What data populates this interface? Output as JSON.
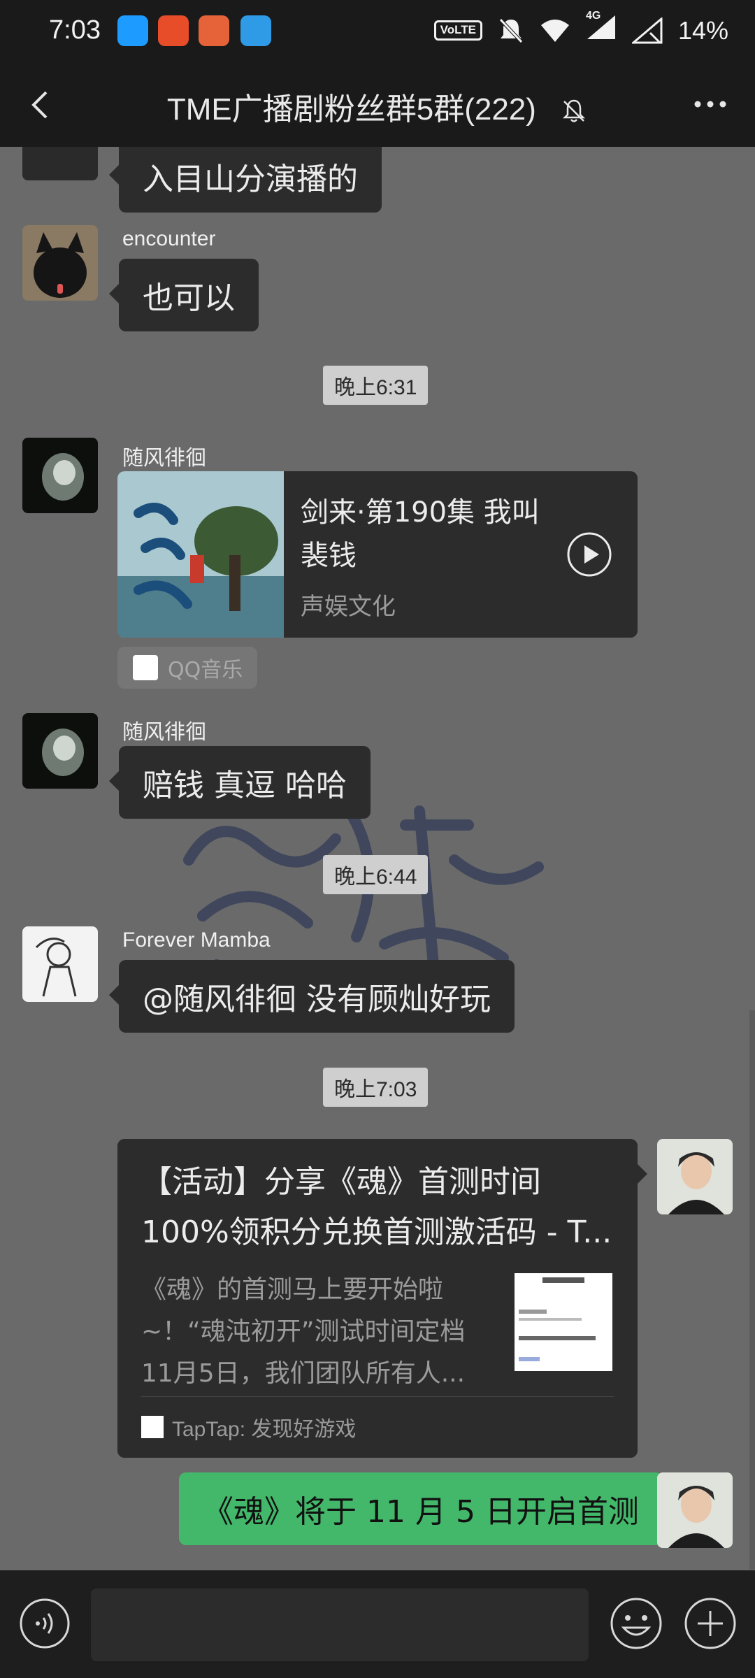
{
  "status_bar": {
    "time": "7:03",
    "volte": "VoLTE",
    "network": "4G",
    "battery": "14%"
  },
  "header": {
    "title": "TME广播剧粉丝群5群(222)"
  },
  "messages": {
    "m0_text": "入目山分演播的",
    "m1_name": "encounter",
    "m1_text": "也可以",
    "time1": "晚上6:31",
    "m2_name": "随风徘徊",
    "m2_music_title": "剑来·第190集 我叫裴钱",
    "m2_music_artist": "声娱文化",
    "m2_source": "QQ音乐",
    "m3_name": "随风徘徊",
    "m3_text": "赔钱 真逗 哈哈",
    "time2": "晚上6:44",
    "m4_name": "Forever Mamba",
    "m4_text": "@随风徘徊  没有顾灿好玩",
    "time3": "晚上7:03",
    "m5_title": "【活动】分享《魂》首测时间100%领积分兑换首测激活码 - T...",
    "m5_desc": "《魂》的首测马上要开始啦~！“魂沌初开”测试时间定档11月5日，我们团队所有人...",
    "m5_source": "TapTap: 发现好游戏",
    "m6_text": "《魂》将于 11 月 5 日开启首测"
  },
  "icons": {
    "back": "back-arrow-icon",
    "mute": "bell-off-icon",
    "more": "more-icon",
    "voice": "voice-icon",
    "emoji": "emoji-icon",
    "plus": "plus-icon"
  },
  "colors": {
    "chat_bg": "#6a6a6a",
    "bubble": "#2c2c2c",
    "self_bubble": "#43b86a",
    "time_chip": "#cfcfcf"
  }
}
